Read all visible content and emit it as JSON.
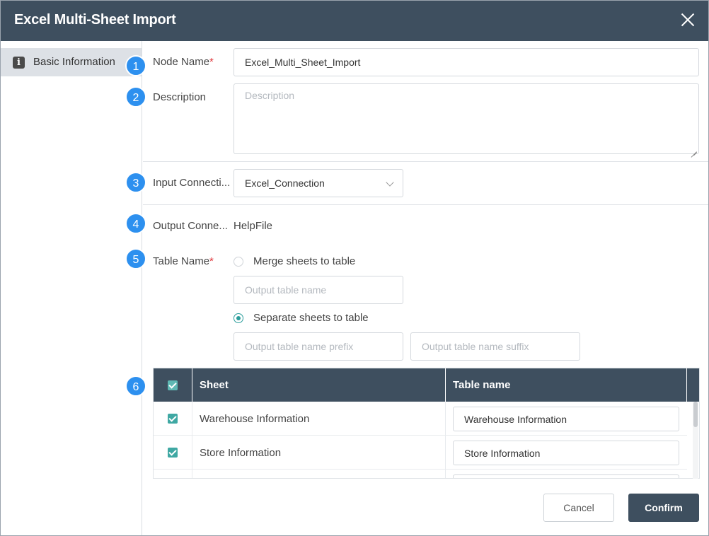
{
  "dialog": {
    "title": "Excel Multi-Sheet Import",
    "close_icon": "close-icon"
  },
  "sidebar": {
    "items": [
      {
        "label": "Basic Information",
        "icon": "info-icon",
        "icon_glyph": "i",
        "active": true
      }
    ]
  },
  "form": {
    "node_name": {
      "step": "1",
      "label": "Node Name",
      "required_mark": "*",
      "value": "Excel_Multi_Sheet_Import"
    },
    "description": {
      "step": "2",
      "label": "Description",
      "placeholder": "Description",
      "value": ""
    },
    "input_connection": {
      "step": "3",
      "label": "Input Connecti...",
      "value": "Excel_Connection"
    },
    "output_connection": {
      "step": "4",
      "label": "Output Conne...",
      "value": "HelpFile"
    },
    "table_name": {
      "step": "5",
      "label": "Table Name",
      "required_mark": "*",
      "merge_option": {
        "label": "Merge sheets to table",
        "checked": false
      },
      "merge_placeholder": "Output table name",
      "separate_option": {
        "label": "Separate sheets to table",
        "checked": true
      },
      "prefix_placeholder": "Output table name prefix",
      "suffix_placeholder": "Output table name suffix"
    },
    "sheet_table": {
      "step": "6",
      "headers": {
        "sheet": "Sheet",
        "table_name": "Table name"
      },
      "header_checked": true,
      "rows": [
        {
          "sheet": "Warehouse Information",
          "table_name": "Warehouse Information",
          "checked": true
        },
        {
          "sheet": "Store Information",
          "table_name": "Store Information",
          "checked": true
        }
      ]
    }
  },
  "footer": {
    "cancel_label": "Cancel",
    "confirm_label": "Confirm"
  },
  "colors": {
    "header_bg": "#3e4f5f",
    "step_badge": "#2d90ef",
    "accent_teal": "#3fa8a3",
    "required": "#e0393e"
  }
}
